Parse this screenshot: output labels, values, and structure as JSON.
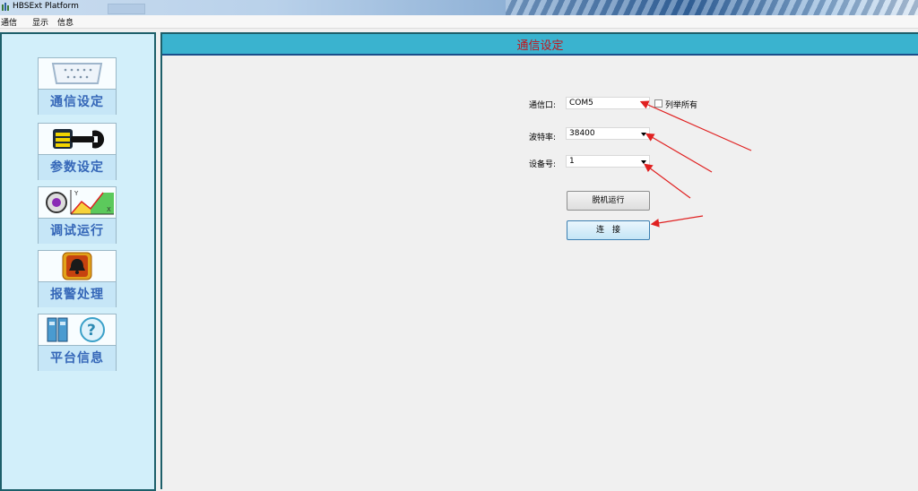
{
  "window": {
    "title": "HBSExt Platform"
  },
  "menu": {
    "items": [
      "通信",
      "显示",
      "信息"
    ]
  },
  "sidebar": {
    "items": [
      {
        "label": "通信设定",
        "icon": "serial-port-icon"
      },
      {
        "label": "参数设定",
        "icon": "wrench-icon"
      },
      {
        "label": "调试运行",
        "icon": "graph-gear-icon"
      },
      {
        "label": "报警处理",
        "icon": "alarm-bell-icon"
      },
      {
        "label": "平台信息",
        "icon": "help-device-icon"
      }
    ]
  },
  "main": {
    "header_title": "通信设定",
    "form": {
      "port_label": "通信口:",
      "port_value": "COM5",
      "list_all_label": "列举所有",
      "list_all_checked": false,
      "baud_label": "波特率:",
      "baud_value": "38400",
      "device_label": "设备号:",
      "device_value": "1"
    },
    "buttons": {
      "offline_label": "脱机运行",
      "connect_label": "连　接"
    }
  },
  "colors": {
    "sidebar_bg": "#d2effa",
    "sidebar_label": "#3567b8",
    "header_bg": "#3ab3cf",
    "header_title": "#c2151b",
    "annotation_arrow": "#e02020"
  }
}
